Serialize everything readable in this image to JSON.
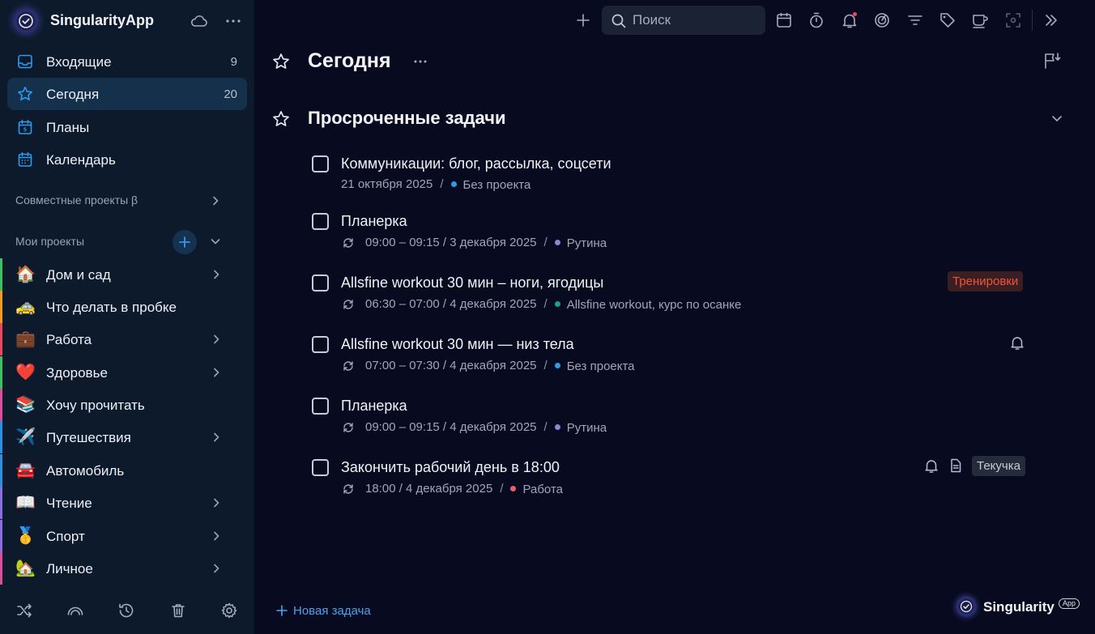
{
  "app": {
    "name": "SingularityApp"
  },
  "sidebar": {
    "nav": [
      {
        "label": "Входящие",
        "count": "9",
        "icon": "inbox-icon"
      },
      {
        "label": "Сегодня",
        "count": "20",
        "icon": "star-icon"
      },
      {
        "label": "Планы",
        "count": "",
        "icon": "plans-calendar-icon"
      },
      {
        "label": "Календарь",
        "count": "",
        "icon": "calendar-icon"
      }
    ],
    "shared_projects_label": "Совместные проекты β",
    "my_projects_label": "Мои проекты",
    "projects": [
      {
        "label": "Дом и сад",
        "emoji": "🏠",
        "color": "#3fbf5f",
        "has_children": true
      },
      {
        "label": "Что делать в пробке",
        "emoji": "🚕",
        "color": "#f29c1f",
        "has_children": false
      },
      {
        "label": "Работа",
        "emoji": "💼",
        "color": "#e8485a",
        "has_children": true
      },
      {
        "label": "Здоровье",
        "emoji": "❤️",
        "color": "#3fbf5f",
        "has_children": true
      },
      {
        "label": "Хочу прочитать",
        "emoji": "📚",
        "color": "#d94f9c",
        "has_children": false
      },
      {
        "label": "Путешествия",
        "emoji": "✈️",
        "color": "#2e8fe0",
        "has_children": true
      },
      {
        "label": "Автомобиль",
        "emoji": "🚘",
        "color": "#2e8fe0",
        "has_children": false
      },
      {
        "label": "Чтение",
        "emoji": "📖",
        "color": "#8a6ee0",
        "has_children": true
      },
      {
        "label": "Спорт",
        "emoji": "🥇",
        "color": "#8a6ee0",
        "has_children": true
      },
      {
        "label": "Личное",
        "emoji": "🏡",
        "color": "#d94f9c",
        "has_children": true
      }
    ]
  },
  "toolbar": {
    "search_placeholder": "Поиск"
  },
  "main": {
    "title": "Сегодня",
    "section_title": "Просроченные задачи",
    "tasks": [
      {
        "title": "Коммуникации: блог, рассылка, соцсети",
        "repeat": false,
        "time": "21 октября 2025",
        "project": "Без проекта",
        "dot": "#2e9be8"
      },
      {
        "title": "Планерка",
        "repeat": true,
        "time": "09:00 – 09:15 / 3 декабря 2025",
        "project": "Рутина",
        "dot": "#8c86d6"
      },
      {
        "title": "Allsfine workout 30 мин – ноги, ягодицы",
        "repeat": true,
        "time": "06:30 – 07:00 / 4 декабря 2025",
        "project": "Allsfine workout, курс по осанке",
        "dot": "#1f9f86",
        "tag": "Тренировки",
        "tag_color": "#f0553a",
        "tag_bg": "#3a1e22"
      },
      {
        "title": "Allsfine workout 30 мин — низ тела",
        "repeat": true,
        "time": "07:00 – 07:30 / 4 декабря 2025",
        "project": "Без проекта",
        "dot": "#2e9be8",
        "reminder": true
      },
      {
        "title": "Планерка",
        "repeat": true,
        "time": "09:00 – 09:15 / 4 декабря 2025",
        "project": "Рутина",
        "dot": "#8c86d6"
      },
      {
        "title": "Закончить рабочий день в 18:00",
        "repeat": true,
        "time": "18:00 / 4 декабря 2025",
        "project": "Работа",
        "dot": "#e8606c",
        "reminder": true,
        "note": true,
        "tag": "Текучка",
        "tag_color": "#c8cbd6",
        "tag_bg": "#262b3b"
      }
    ],
    "new_task_label": "Новая задача"
  },
  "brand": {
    "name": "Singularity",
    "badge": "App"
  },
  "colors": {
    "sidebar_bg": "#0c1a2c",
    "main_bg": "#080a1f",
    "accent": "#4aa3f0",
    "active_bg": "#15304b"
  }
}
